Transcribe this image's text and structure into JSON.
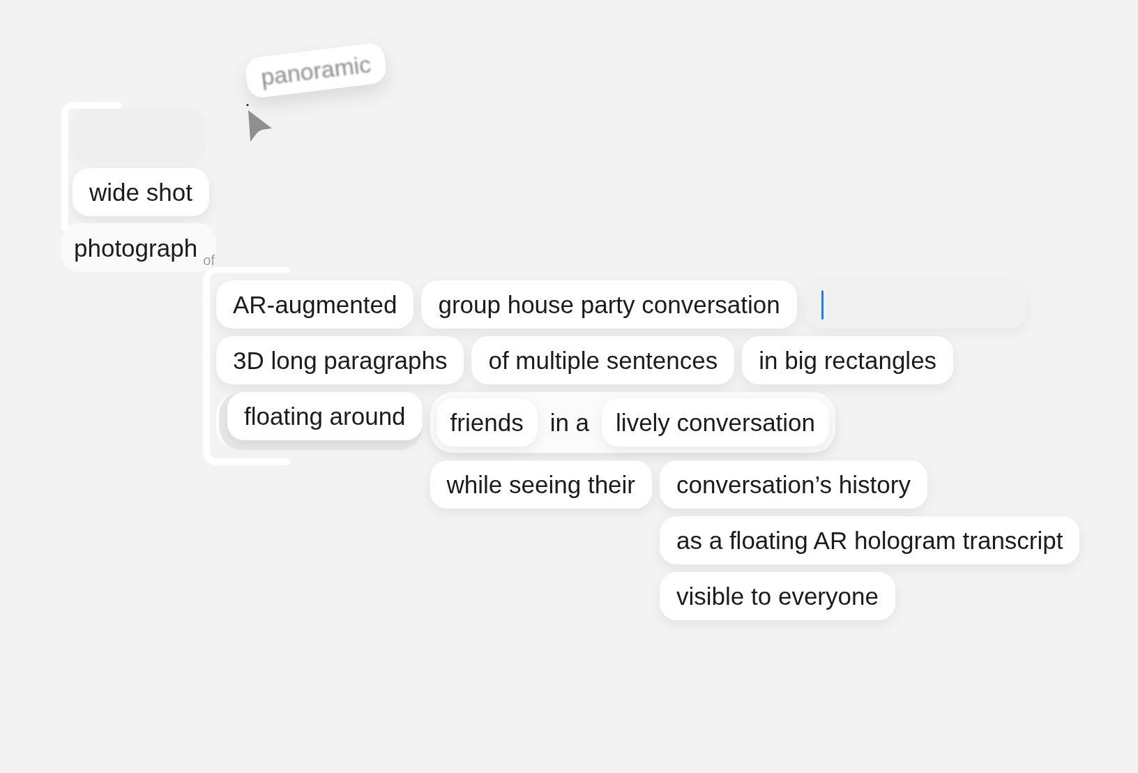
{
  "dragged_chip": {
    "label": "panoramic"
  },
  "tree": {
    "modifiers": [
      {
        "kind": "drop_slot"
      },
      {
        "kind": "chip",
        "label": "wide shot"
      }
    ],
    "head": {
      "label": "photograph",
      "connector": "of"
    },
    "lines": [
      [
        {
          "kind": "chip",
          "label": "AR-augmented"
        },
        {
          "kind": "chip",
          "label": "group house party conversation"
        },
        {
          "kind": "input",
          "focused": true
        }
      ],
      [
        {
          "kind": "chip",
          "label": "3D long paragraphs"
        },
        {
          "kind": "chip",
          "label": "of multiple sentences"
        },
        {
          "kind": "chip",
          "label": "in big rectangles"
        }
      ],
      [
        {
          "kind": "bracketed",
          "items": [
            {
              "kind": "chip",
              "label": "floating around"
            }
          ]
        },
        {
          "kind": "group",
          "items": [
            {
              "kind": "chip",
              "label": "friends"
            },
            {
              "kind": "word",
              "label": "in a"
            },
            {
              "kind": "chip",
              "label": "lively conversation"
            }
          ],
          "lines": [
            [
              {
                "kind": "chip",
                "label": "while seeing their"
              },
              {
                "kind": "chip",
                "label": "conversation’s history",
                "lines": [
                  [
                    {
                      "kind": "chip",
                      "label": "as a floating AR hologram transcript"
                    }
                  ],
                  [
                    {
                      "kind": "chip",
                      "label": "visible to everyone"
                    }
                  ]
                ]
              }
            ]
          ]
        }
      ]
    ]
  }
}
